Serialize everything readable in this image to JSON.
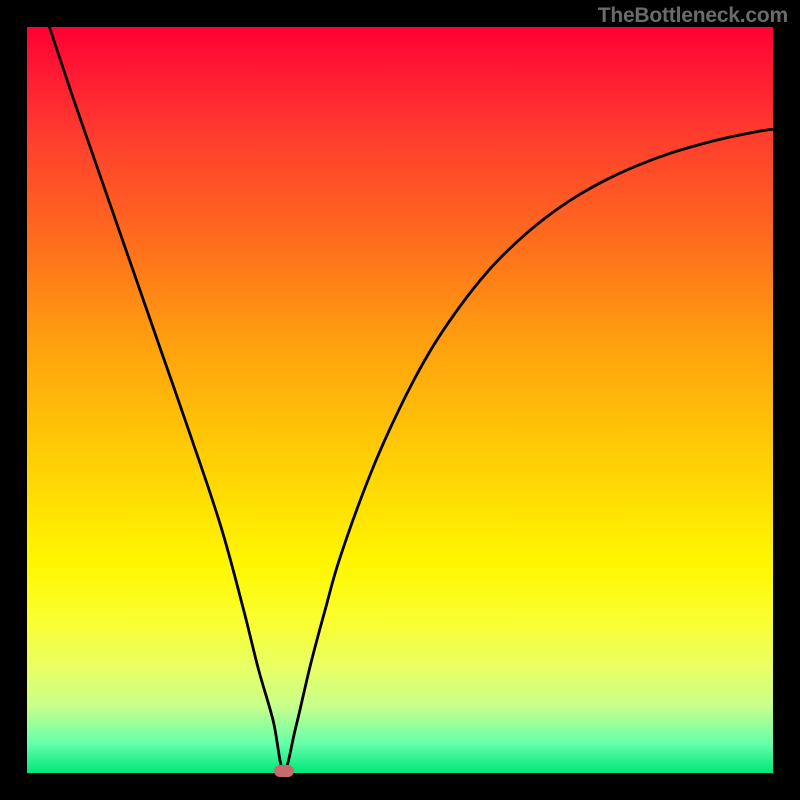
{
  "watermark": "TheBottleneck.com",
  "chart_data": {
    "type": "line",
    "title": "",
    "xlabel": "",
    "ylabel": "",
    "xlim": [
      0,
      100
    ],
    "ylim": [
      0,
      100
    ],
    "grid": false,
    "legend": false,
    "series": [
      {
        "name": "curve",
        "x": [
          3,
          6,
          10,
          14,
          18,
          22,
          26,
          29,
          31,
          33,
          34.4,
          36,
          38,
          40,
          42,
          46,
          50,
          54,
          58,
          62,
          66,
          70,
          74,
          78,
          82,
          86,
          90,
          94,
          98,
          100
        ],
        "y": [
          100,
          91,
          79.5,
          68,
          56.5,
          45,
          33,
          22,
          14,
          7,
          0.3,
          6,
          14.5,
          22,
          29,
          40,
          49,
          56.5,
          62.5,
          67.5,
          71.5,
          74.8,
          77.5,
          79.7,
          81.5,
          83,
          84.2,
          85.2,
          86,
          86.3
        ]
      }
    ],
    "marker": {
      "x": 34.4,
      "y": 0.3,
      "color": "#c56b6b"
    },
    "background_gradient": [
      {
        "stop": 0.0,
        "color": "#ff0033"
      },
      {
        "stop": 0.15,
        "color": "#ff3e2e"
      },
      {
        "stop": 0.42,
        "color": "#ff9f0f"
      },
      {
        "stop": 0.72,
        "color": "#fff700"
      },
      {
        "stop": 0.91,
        "color": "#c8ff8a"
      },
      {
        "stop": 1.0,
        "color": "#00e67a"
      }
    ]
  }
}
